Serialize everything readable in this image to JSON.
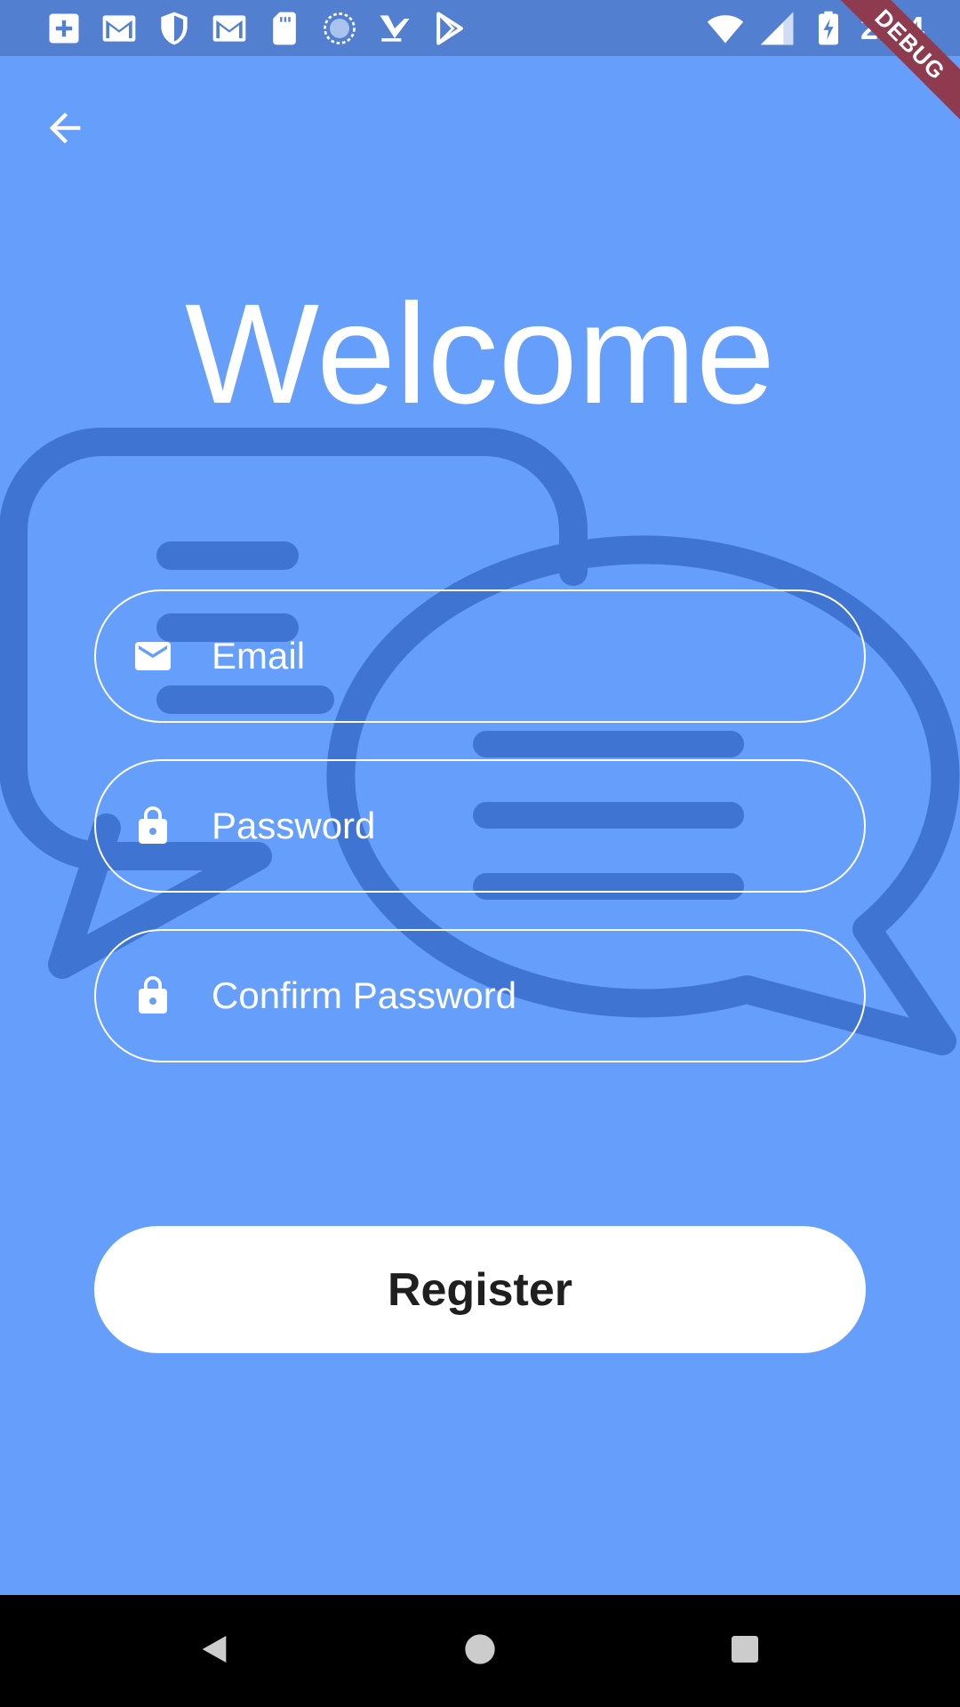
{
  "status_bar": {
    "time": "2:04",
    "left_icons": [
      "photo-add-icon",
      "gmail-icon",
      "shield-icon",
      "gmail-icon",
      "sd-card-icon",
      "loading-icon",
      "check-arrow-icon",
      "play-store-icon"
    ],
    "right_icons": [
      "wifi-icon",
      "signal-icon",
      "battery-charging-icon"
    ]
  },
  "debug_banner": {
    "label": "DEBUG"
  },
  "header": {
    "back_icon": "arrow-back-icon"
  },
  "main": {
    "title": "Welcome",
    "fields": {
      "email": {
        "placeholder": "Email",
        "value": "",
        "icon": "email-icon"
      },
      "password": {
        "placeholder": "Password",
        "value": "",
        "icon": "lock-icon"
      },
      "confirm_password": {
        "placeholder": "Confirm Password",
        "value": "",
        "icon": "lock-icon"
      }
    },
    "register_label": "Register"
  },
  "nav_bar": {
    "back_icon": "nav-back-icon",
    "home_icon": "nav-home-icon",
    "recents_icon": "nav-recents-icon"
  },
  "colors": {
    "background": "#659efb",
    "status_bar": "#527fd0",
    "art": "#3f74d2",
    "button": "#ffffff",
    "text": "#ffffff"
  }
}
